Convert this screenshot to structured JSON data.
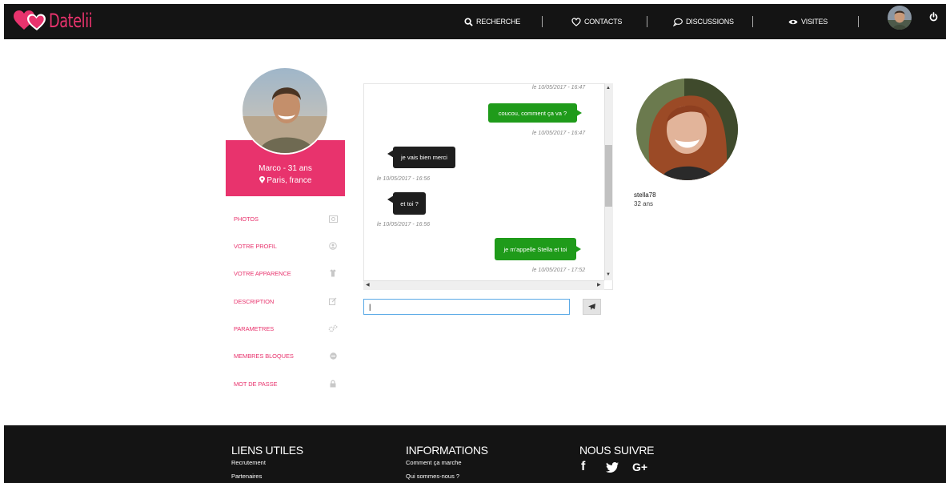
{
  "colors": {
    "brand": "#e8336d",
    "header_bg": "#141414",
    "bubble_sent": "#1f9b1a",
    "bubble_received": "#1e1e1e",
    "input_focus": "#5aa9e6"
  },
  "header": {
    "logo": "Datelii",
    "nav": [
      {
        "label": "RECHERCHE",
        "icon": "search-icon"
      },
      {
        "label": "CONTACTS",
        "icon": "heart-icon"
      },
      {
        "label": "DISCUSSIONS",
        "icon": "chat-bubble-icon"
      },
      {
        "label": "VISITES",
        "icon": "eye-icon"
      }
    ]
  },
  "profile": {
    "name": "Marco - 31 ans",
    "city": "Paris, france"
  },
  "menu": [
    {
      "label": "PHOTOS",
      "icon": "image-icon"
    },
    {
      "label": "VOTRE PROFIL",
      "icon": "user-circle-icon"
    },
    {
      "label": "VOTRE APPARENCE",
      "icon": "shirt-icon"
    },
    {
      "label": "DESCRIPTION",
      "icon": "edit-icon"
    },
    {
      "label": "PARAMETRES",
      "icon": "gears-icon"
    },
    {
      "label": "MEMBRES BLOQUES",
      "icon": "block-icon"
    },
    {
      "label": "MOT DE PASSE",
      "icon": "lock-icon"
    }
  ],
  "chat": {
    "messages": [
      {
        "time": "le 10/05/2017 - 16:47",
        "side": "sent",
        "text": ""
      },
      {
        "time": "le 10/05/2017 - 16:47",
        "side": "sent",
        "text": "coucou, comment ça va ?"
      },
      {
        "time": "le 10/05/2017 - 16:56",
        "side": "received",
        "text": "je vais bien merci"
      },
      {
        "time": "le 10/05/2017 - 16:56",
        "side": "received",
        "text": "et toi ?"
      },
      {
        "time": "le 10/05/2017 - 17:52",
        "side": "sent",
        "text": "je m'appelle Stella et toi"
      }
    ],
    "input_value": "|"
  },
  "contact": {
    "username": "stella78",
    "age": "32 ans"
  },
  "footer": {
    "columns": [
      {
        "title": "LIENS UTILES",
        "links": [
          "Recrutement",
          "Partenaires"
        ]
      },
      {
        "title": "INFORMATIONS",
        "links": [
          "Comment ça marche",
          "Qui sommes-nous ?"
        ]
      },
      {
        "title": "NOUS SUIVRE",
        "links": []
      }
    ],
    "social": [
      "facebook-icon",
      "twitter-icon",
      "google-plus-icon"
    ],
    "social_labels": [
      "f",
      "G+"
    ]
  }
}
